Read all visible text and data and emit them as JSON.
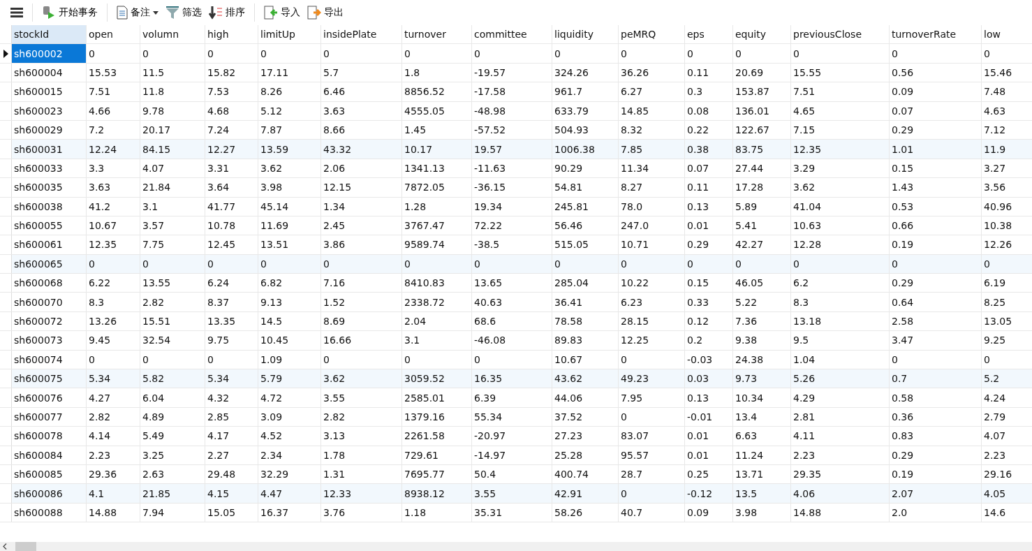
{
  "toolbar": [
    {
      "kind": "menu"
    },
    {
      "kind": "transaction",
      "label": "开始事务"
    },
    {
      "kind": "note",
      "label": "备注",
      "dropdown": true
    },
    {
      "kind": "filter",
      "label": "筛选"
    },
    {
      "kind": "sort",
      "label": "排序"
    },
    {
      "kind": "import",
      "label": "导入"
    },
    {
      "kind": "export",
      "label": "导出"
    }
  ],
  "table": {
    "columns": [
      "stockId",
      "open",
      "volumn",
      "high",
      "limitUp",
      "insidePlate",
      "turnover",
      "committee",
      "liquidity",
      "peMRQ",
      "eps",
      "equity",
      "previousClose",
      "turnoverRate",
      "low"
    ],
    "rows": [
      {
        "selected": true,
        "tinted": false,
        "cells": [
          "sh600002",
          "0",
          "0",
          "0",
          "0",
          "0",
          "0",
          "0",
          "0",
          "0",
          "0",
          "0",
          "0",
          "0",
          "0"
        ]
      },
      {
        "selected": false,
        "tinted": false,
        "cells": [
          "sh600004",
          "15.53",
          "11.5",
          "15.82",
          "17.11",
          "5.7",
          "1.8",
          "-19.57",
          "324.26",
          "36.26",
          "0.11",
          "20.69",
          "15.55",
          "0.56",
          "15.46"
        ]
      },
      {
        "selected": false,
        "tinted": false,
        "cells": [
          "sh600015",
          "7.51",
          "11.8",
          "7.53",
          "8.26",
          "6.46",
          "8856.52",
          "-17.58",
          "961.7",
          "6.27",
          "0.3",
          "153.87",
          "7.51",
          "0.09",
          "7.48"
        ]
      },
      {
        "selected": false,
        "tinted": false,
        "cells": [
          "sh600023",
          "4.66",
          "9.78",
          "4.68",
          "5.12",
          "3.63",
          "4555.05",
          "-48.98",
          "633.79",
          "14.85",
          "0.08",
          "136.01",
          "4.65",
          "0.07",
          "4.63"
        ]
      },
      {
        "selected": false,
        "tinted": false,
        "cells": [
          "sh600029",
          "7.2",
          "20.17",
          "7.24",
          "7.87",
          "8.66",
          "1.45",
          "-57.52",
          "504.93",
          "8.32",
          "0.22",
          "122.67",
          "7.15",
          "0.29",
          "7.12"
        ]
      },
      {
        "selected": false,
        "tinted": true,
        "cells": [
          "sh600031",
          "12.24",
          "84.15",
          "12.27",
          "13.59",
          "43.32",
          "10.17",
          "19.57",
          "1006.38",
          "7.85",
          "0.38",
          "83.75",
          "12.35",
          "1.01",
          "11.9"
        ]
      },
      {
        "selected": false,
        "tinted": false,
        "cells": [
          "sh600033",
          "3.3",
          "4.07",
          "3.31",
          "3.62",
          "2.06",
          "1341.13",
          "-11.63",
          "90.29",
          "11.34",
          "0.07",
          "27.44",
          "3.29",
          "0.15",
          "3.27"
        ]
      },
      {
        "selected": false,
        "tinted": false,
        "cells": [
          "sh600035",
          "3.63",
          "21.84",
          "3.64",
          "3.98",
          "12.15",
          "7872.05",
          "-36.15",
          "54.81",
          "8.27",
          "0.11",
          "17.28",
          "3.62",
          "1.43",
          "3.56"
        ]
      },
      {
        "selected": false,
        "tinted": false,
        "cells": [
          "sh600038",
          "41.2",
          "3.1",
          "41.77",
          "45.14",
          "1.34",
          "1.28",
          "19.34",
          "245.81",
          "78.0",
          "0.13",
          "5.89",
          "41.04",
          "0.53",
          "40.96"
        ]
      },
      {
        "selected": false,
        "tinted": false,
        "cells": [
          "sh600055",
          "10.67",
          "3.57",
          "10.78",
          "11.69",
          "2.45",
          "3767.47",
          "72.22",
          "56.46",
          "247.0",
          "0.01",
          "5.41",
          "10.63",
          "0.66",
          "10.38"
        ]
      },
      {
        "selected": false,
        "tinted": false,
        "cells": [
          "sh600061",
          "12.35",
          "7.75",
          "12.45",
          "13.51",
          "3.86",
          "9589.74",
          "-38.5",
          "515.05",
          "10.71",
          "0.29",
          "42.27",
          "12.28",
          "0.19",
          "12.26"
        ]
      },
      {
        "selected": false,
        "tinted": true,
        "cells": [
          "sh600065",
          "0",
          "0",
          "0",
          "0",
          "0",
          "0",
          "0",
          "0",
          "0",
          "0",
          "0",
          "0",
          "0",
          "0"
        ]
      },
      {
        "selected": false,
        "tinted": false,
        "cells": [
          "sh600068",
          "6.22",
          "13.55",
          "6.24",
          "6.82",
          "7.16",
          "8410.83",
          "13.65",
          "285.04",
          "10.22",
          "0.15",
          "46.05",
          "6.2",
          "0.29",
          "6.19"
        ]
      },
      {
        "selected": false,
        "tinted": false,
        "cells": [
          "sh600070",
          "8.3",
          "2.82",
          "8.37",
          "9.13",
          "1.52",
          "2338.72",
          "40.63",
          "36.41",
          "6.23",
          "0.33",
          "5.22",
          "8.3",
          "0.64",
          "8.25"
        ]
      },
      {
        "selected": false,
        "tinted": false,
        "cells": [
          "sh600072",
          "13.26",
          "15.51",
          "13.35",
          "14.5",
          "8.69",
          "2.04",
          "68.6",
          "78.58",
          "28.15",
          "0.12",
          "7.36",
          "13.18",
          "2.58",
          "13.05"
        ]
      },
      {
        "selected": false,
        "tinted": false,
        "cells": [
          "sh600073",
          "9.45",
          "32.54",
          "9.75",
          "10.45",
          "16.66",
          "3.1",
          "-46.08",
          "89.83",
          "12.25",
          "0.2",
          "9.38",
          "9.5",
          "3.47",
          "9.25"
        ]
      },
      {
        "selected": false,
        "tinted": false,
        "cells": [
          "sh600074",
          "0",
          "0",
          "0",
          "1.09",
          "0",
          "0",
          "0",
          "10.67",
          "0",
          "-0.03",
          "24.38",
          "1.04",
          "0",
          "0"
        ]
      },
      {
        "selected": false,
        "tinted": true,
        "cells": [
          "sh600075",
          "5.34",
          "5.82",
          "5.34",
          "5.79",
          "3.62",
          "3059.52",
          "16.35",
          "43.62",
          "49.23",
          "0.03",
          "9.73",
          "5.26",
          "0.7",
          "5.2"
        ]
      },
      {
        "selected": false,
        "tinted": false,
        "cells": [
          "sh600076",
          "4.27",
          "6.04",
          "4.32",
          "4.72",
          "3.55",
          "2585.01",
          "6.39",
          "44.06",
          "7.95",
          "0.13",
          "10.34",
          "4.29",
          "0.58",
          "4.24"
        ]
      },
      {
        "selected": false,
        "tinted": false,
        "cells": [
          "sh600077",
          "2.82",
          "4.89",
          "2.85",
          "3.09",
          "2.82",
          "1379.16",
          "55.34",
          "37.52",
          "0",
          "-0.01",
          "13.4",
          "2.81",
          "0.36",
          "2.79"
        ]
      },
      {
        "selected": false,
        "tinted": false,
        "cells": [
          "sh600078",
          "4.14",
          "5.49",
          "4.17",
          "4.52",
          "3.13",
          "2261.58",
          "-20.97",
          "27.23",
          "83.07",
          "0.01",
          "6.63",
          "4.11",
          "0.83",
          "4.07"
        ]
      },
      {
        "selected": false,
        "tinted": false,
        "cells": [
          "sh600084",
          "2.23",
          "3.25",
          "2.27",
          "2.34",
          "1.78",
          "729.61",
          "-14.97",
          "25.28",
          "95.57",
          "0.01",
          "11.24",
          "2.23",
          "0.29",
          "2.23"
        ]
      },
      {
        "selected": false,
        "tinted": false,
        "cells": [
          "sh600085",
          "29.36",
          "2.63",
          "29.48",
          "32.29",
          "1.31",
          "7695.77",
          "50.4",
          "400.74",
          "28.7",
          "0.25",
          "13.71",
          "29.35",
          "0.19",
          "29.16"
        ]
      },
      {
        "selected": false,
        "tinted": true,
        "cells": [
          "sh600086",
          "4.1",
          "21.85",
          "4.15",
          "4.47",
          "12.33",
          "8938.12",
          "3.55",
          "42.91",
          "0",
          "-0.12",
          "13.5",
          "4.06",
          "2.07",
          "4.05"
        ]
      },
      {
        "selected": false,
        "tinted": false,
        "cells": [
          "sh600088",
          "14.88",
          "7.94",
          "15.05",
          "16.37",
          "3.76",
          "1.18",
          "35.31",
          "58.26",
          "40.7",
          "0.09",
          "3.98",
          "14.88",
          "2.0",
          "14.6"
        ]
      }
    ]
  }
}
